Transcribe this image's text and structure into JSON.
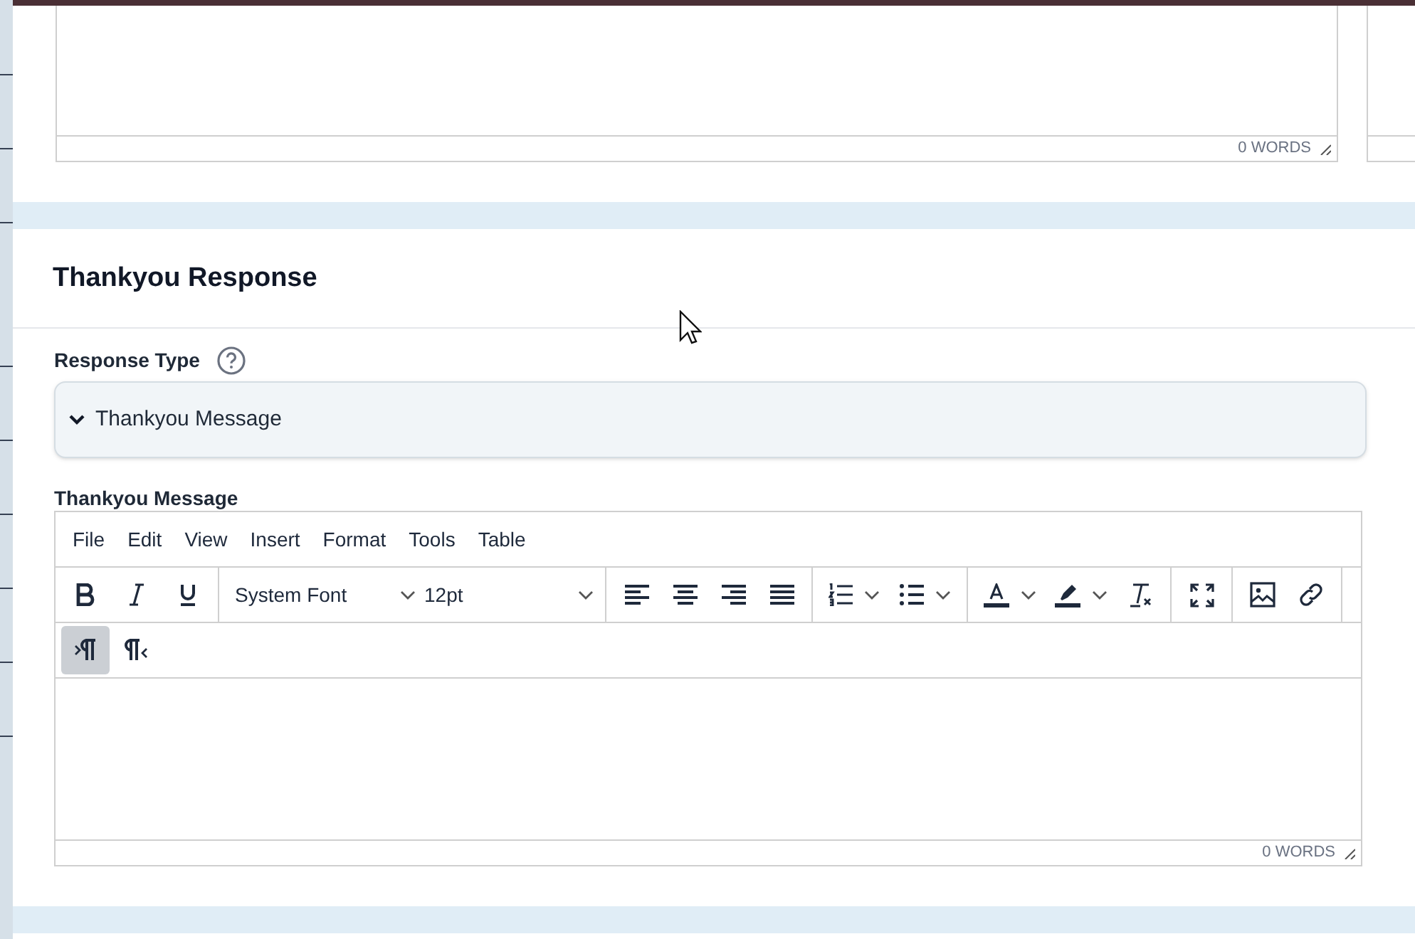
{
  "top_editor": {
    "word_count": "0 WORDS"
  },
  "section": {
    "title": "Thankyou Response"
  },
  "response_type": {
    "label": "Response Type",
    "value": "Thankyou Message"
  },
  "editor": {
    "label": "Thankyou Message",
    "menu": [
      "File",
      "Edit",
      "View",
      "Insert",
      "Format",
      "Tools",
      "Table"
    ],
    "font": "System Font",
    "size": "12pt",
    "direction_buttons": [
      {
        "kind": "ltr",
        "selected": true
      },
      {
        "kind": "rtl",
        "selected": false
      }
    ],
    "word_count": "0 WORDS"
  }
}
